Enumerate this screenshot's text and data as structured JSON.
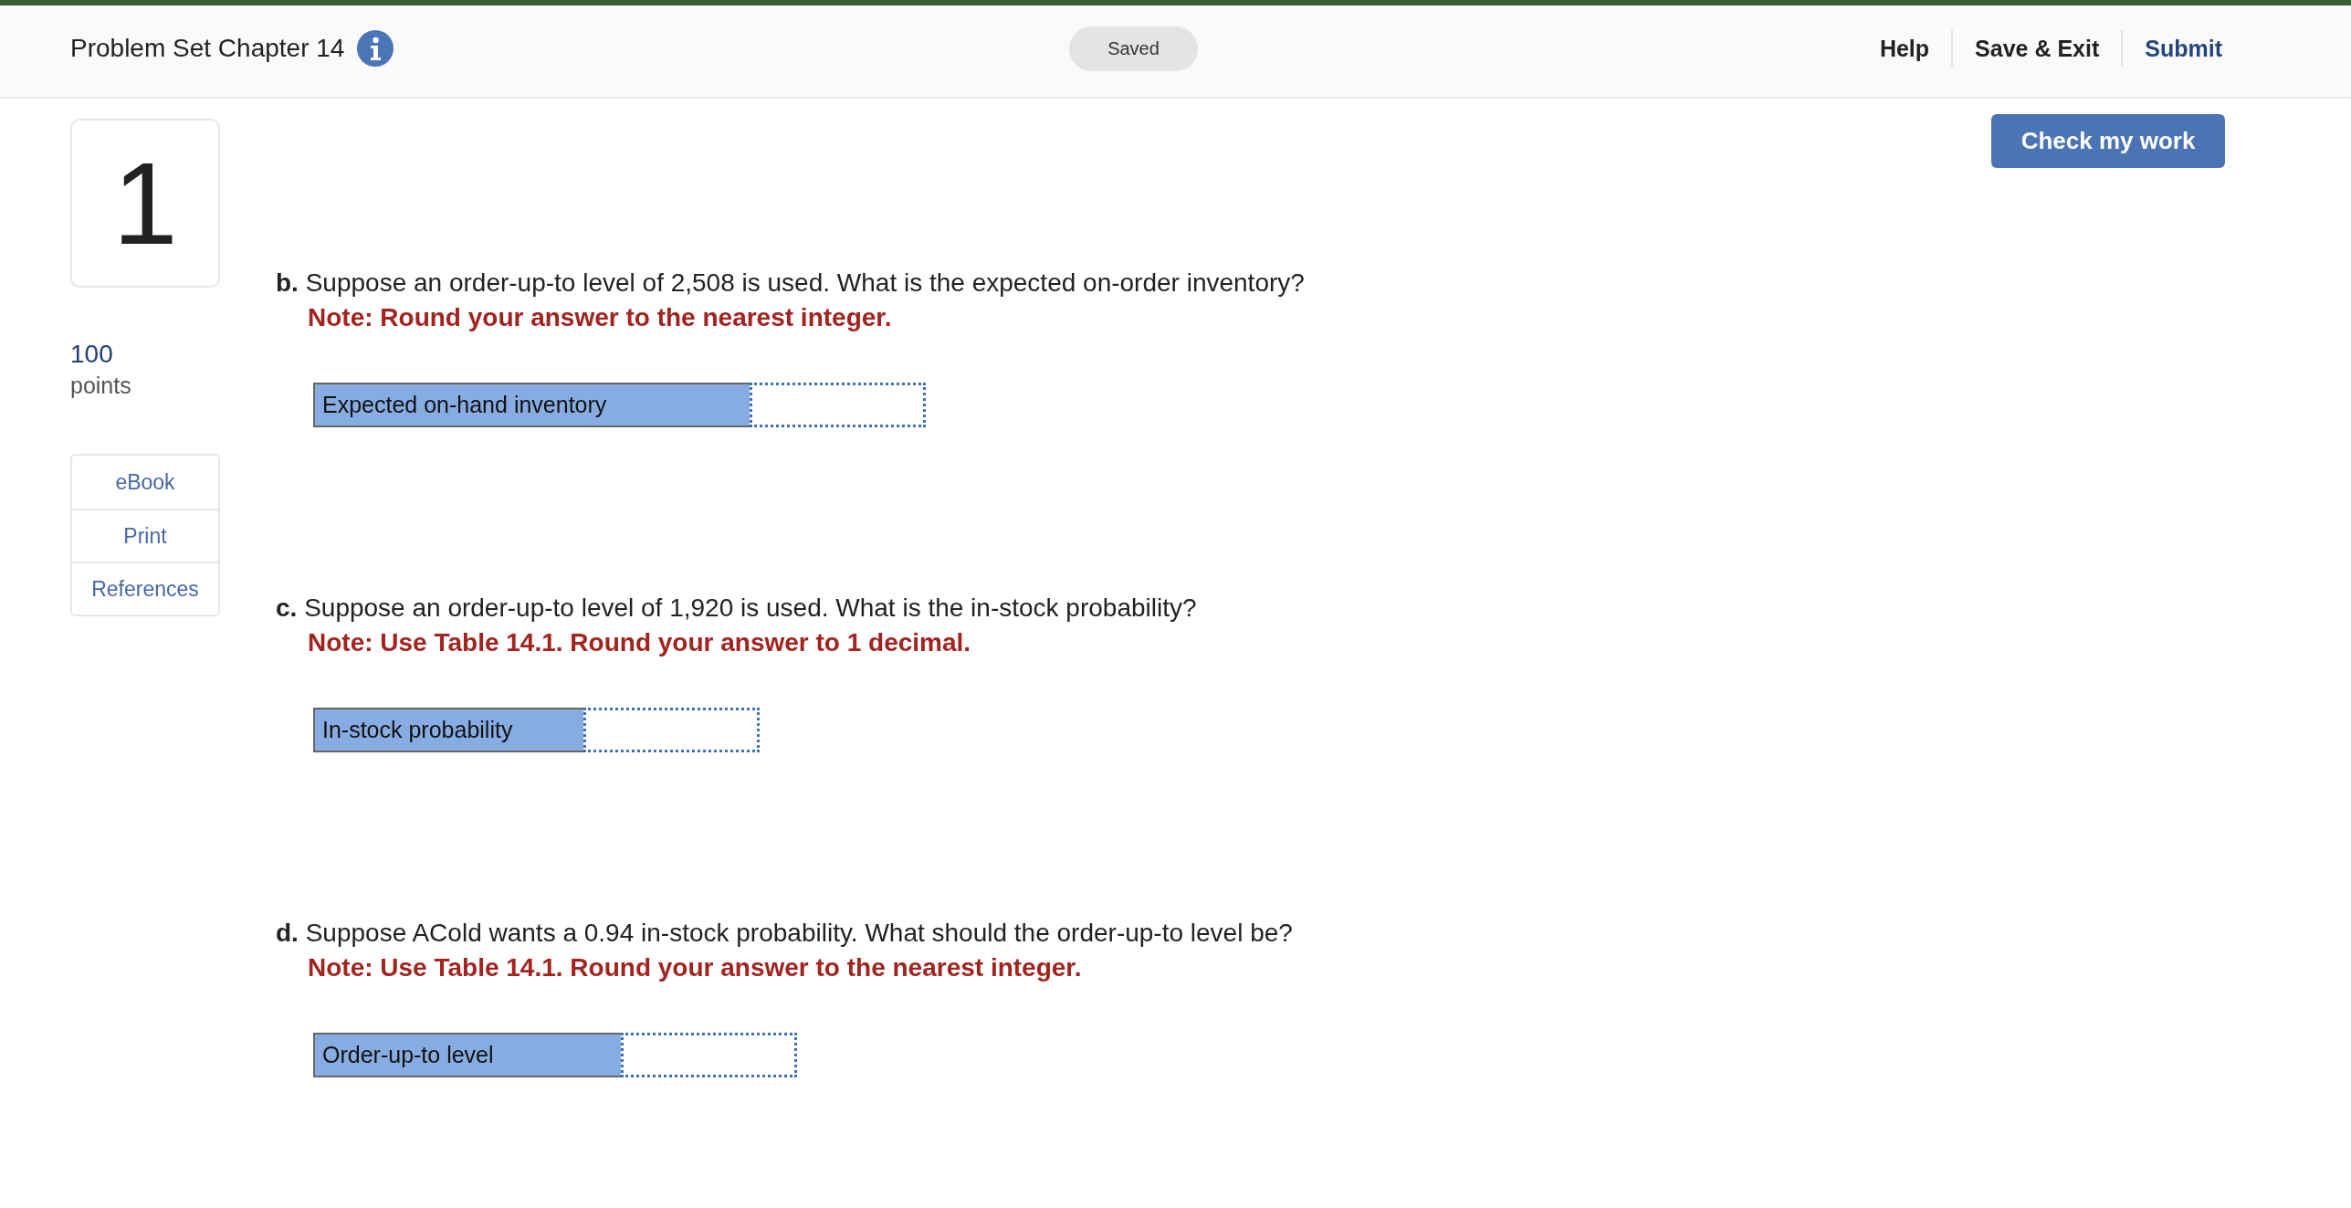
{
  "header": {
    "title": "Problem Set Chapter 14",
    "status": "Saved",
    "actions": [
      {
        "label": "Help",
        "kind": "plain"
      },
      {
        "label": "Save & Exit",
        "kind": "plain"
      },
      {
        "label": "Submit",
        "kind": "primary"
      }
    ]
  },
  "check_button": "Check my work",
  "question": {
    "number": "1",
    "points": "100",
    "points_label": "points",
    "links": [
      "eBook",
      "Print",
      "References"
    ]
  },
  "parts": [
    {
      "text": "**b.** Suppose an order-up-to level of 2,508 is used. What is the expected on-order inventory?",
      "note": "Note: Round your answer to the nearest integer.",
      "answer_label": "Expected on-hand inventory"
    },
    {
      "text": "**c.** Suppose an order-up-to level of 1,920 is used. What is the in-stock probability?",
      "note": "Note: Use Table 14.1. Round your answer to 1 decimal.",
      "answer_label": "In-stock probability"
    },
    {
      "text": "**d.** Suppose ACold wants a 0.94 in-stock probability. What should the order-up-to level be?",
      "note": "Note: Use Table 14.1. Round your answer to the nearest integer.",
      "answer_label": "Order-up-to level"
    }
  ]
}
